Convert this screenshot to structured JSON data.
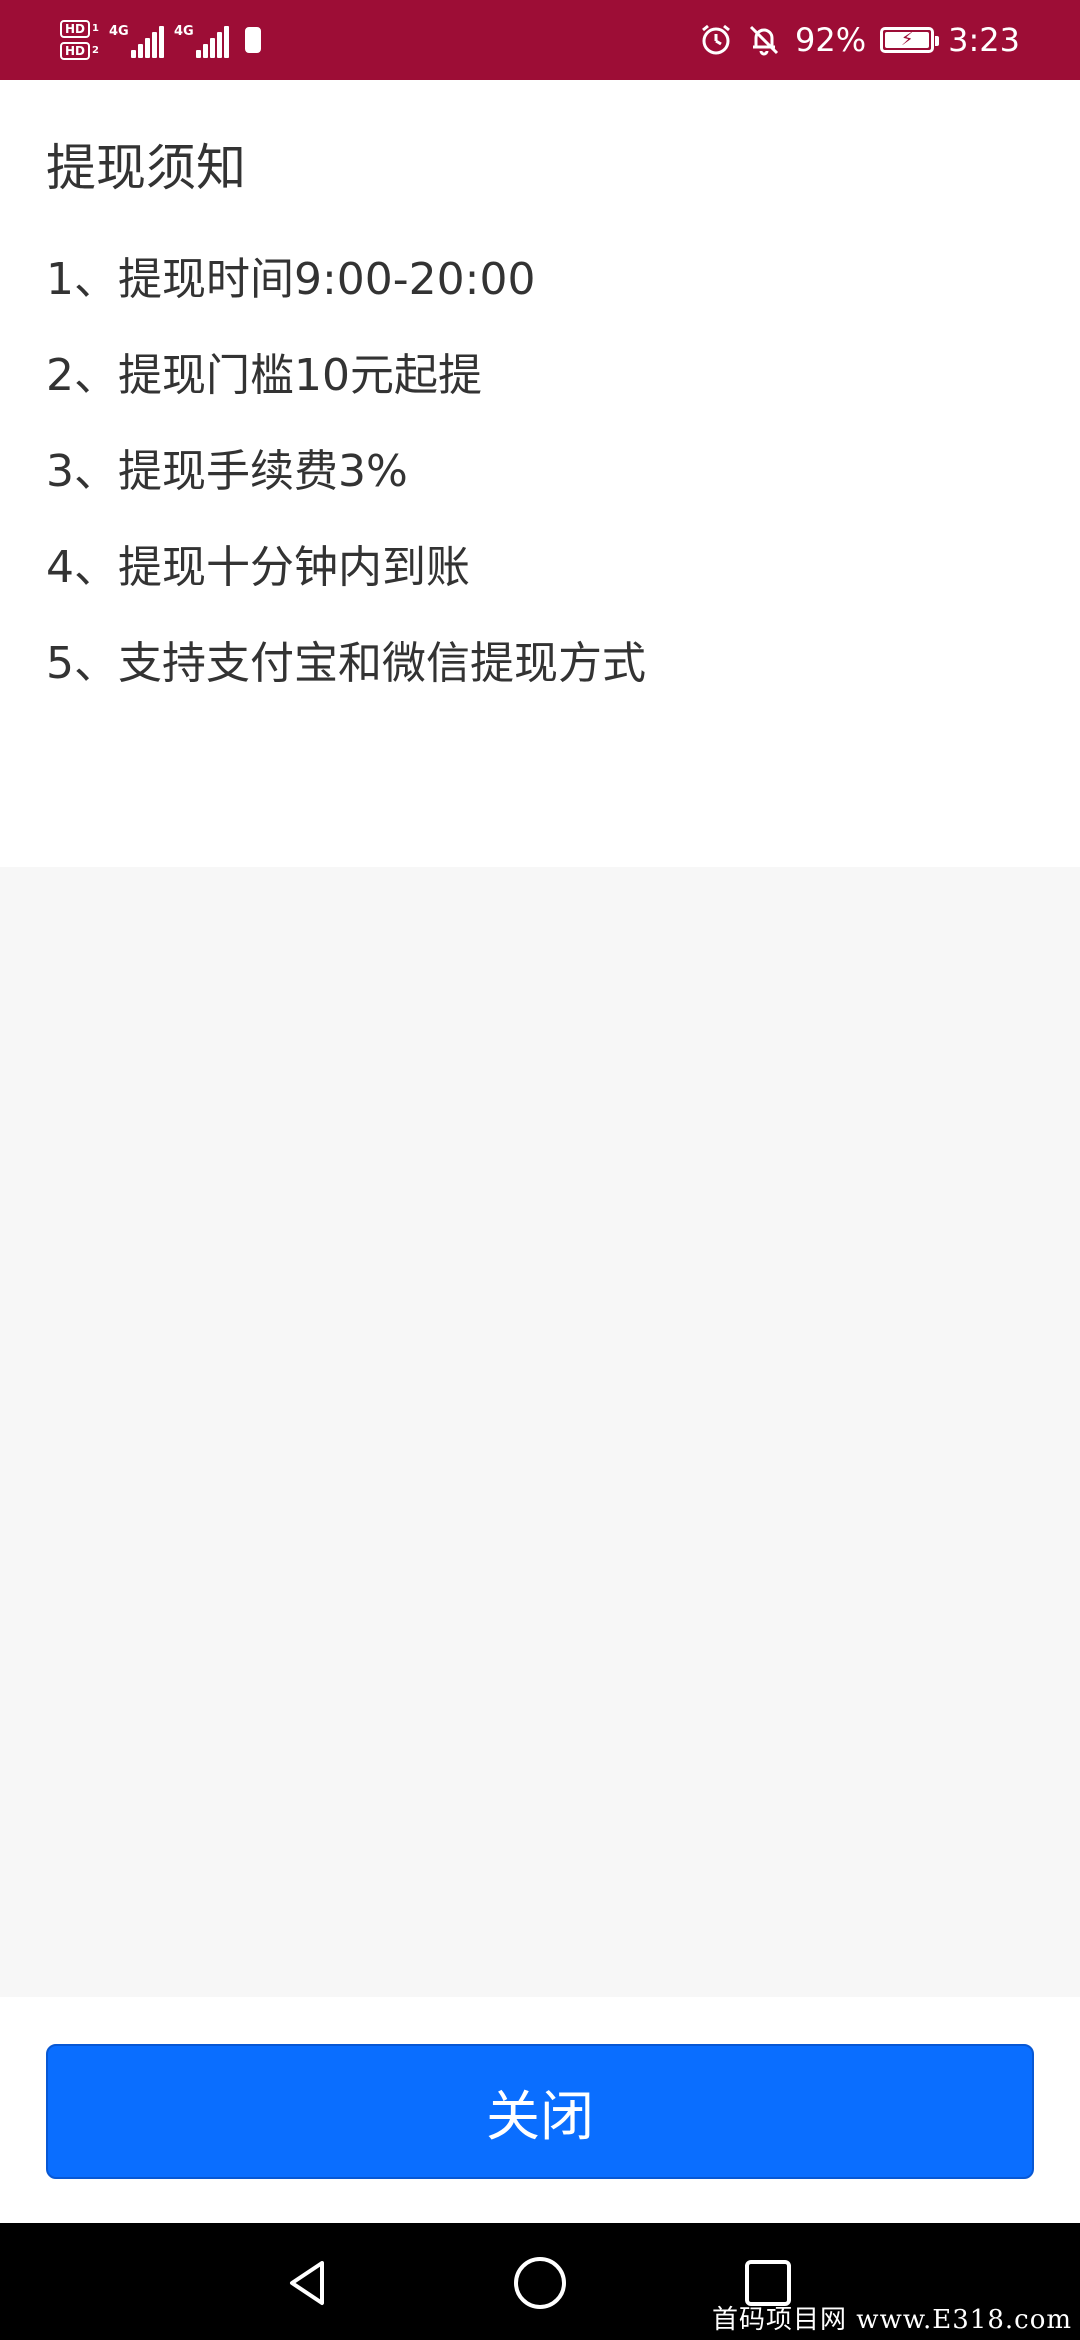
{
  "status_bar": {
    "hd1": "HD",
    "hd1_sim": "1",
    "hd2": "HD",
    "hd2_sim": "2",
    "network1": "4G",
    "network2": "4G",
    "battery_percent": "92%",
    "time": "3:23",
    "icons": [
      "alarm-icon",
      "bell-off-icon",
      "battery-charging-icon"
    ]
  },
  "notice": {
    "title": "提现须知",
    "items": [
      "1、提现时间9:00-20:00",
      "2、提现门槛10元起提",
      "3、提现手续费3%",
      "4、提现十分钟内到账",
      "5、支持支付宝和微信提现方式"
    ]
  },
  "footer": {
    "close_label": "关闭"
  },
  "watermark": "首码项目网 www.E318.com",
  "colors": {
    "status_bar": "#9d0d36",
    "button": "#0a6eff",
    "gray_area": "#f7f7f7",
    "text": "#333333"
  }
}
